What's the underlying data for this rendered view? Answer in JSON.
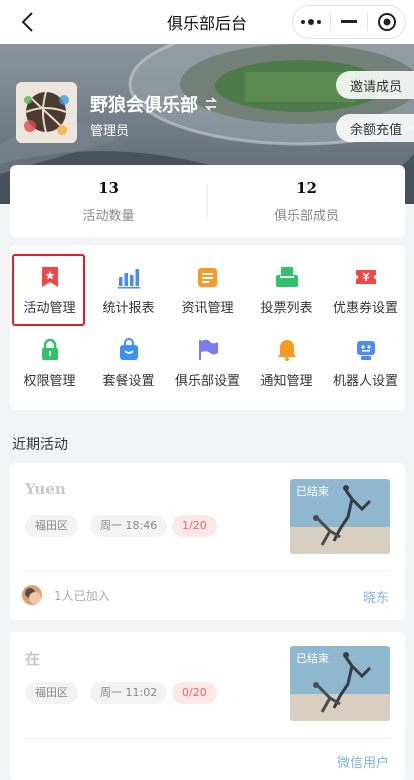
{
  "header": {
    "title": "俱乐部后台"
  },
  "club": {
    "name": "野狼会俱乐部",
    "switch_icon": "swap-icon",
    "role": "管理员"
  },
  "hero_buttons": {
    "invite": "邀请成员",
    "recharge": "余额充值"
  },
  "stats": [
    {
      "value": "13",
      "label": "活动数量"
    },
    {
      "value": "12",
      "label": "俱乐部成员"
    }
  ],
  "menu": [
    {
      "label": "活动管理",
      "icon": "bookmark-star-icon",
      "color": "#f04848"
    },
    {
      "label": "统计报表",
      "icon": "bar-chart-icon",
      "color": "#4a8cf0"
    },
    {
      "label": "资讯管理",
      "icon": "news-icon",
      "color": "#f59a23"
    },
    {
      "label": "投票列表",
      "icon": "ballot-box-icon",
      "color": "#2fc26a"
    },
    {
      "label": "优惠券设置",
      "icon": "coupon-icon",
      "color": "#f04848"
    },
    {
      "label": "权限管理",
      "icon": "lock-icon",
      "color": "#2fc26a"
    },
    {
      "label": "套餐设置",
      "icon": "shopping-bag-icon",
      "color": "#3e8ef7"
    },
    {
      "label": "俱乐部设置",
      "icon": "flag-icon",
      "color": "#7b7cf0"
    },
    {
      "label": "通知管理",
      "icon": "bell-icon",
      "color": "#f59a23"
    },
    {
      "label": "机器人设置",
      "icon": "robot-icon",
      "color": "#4a8cf0"
    }
  ],
  "recent": {
    "title": "近期活动"
  },
  "activities": [
    {
      "title": "Yuen",
      "location": "福田区",
      "time": "周一 18:46",
      "count": "1/20",
      "status": "已结束",
      "joined": "1人已加入",
      "organizer": "晓东"
    },
    {
      "title": "在",
      "location": "福田区",
      "time": "周一 11:02",
      "count": "0/20",
      "status": "已结束",
      "organizer": "微信用户"
    }
  ]
}
